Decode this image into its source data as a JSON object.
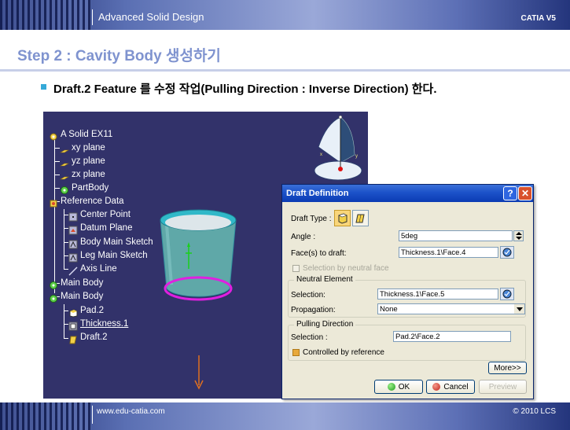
{
  "header": {
    "title": "Advanced Solid Design",
    "product": "CATIA V5"
  },
  "footer": {
    "url": "www.edu-catia.com",
    "copyright": "© 2010 LCS"
  },
  "step_title": "Step 2 : Cavity Body 생성하기",
  "bullet_text": "Draft.2 Feature 를 수정 작업(Pulling Direction : Inverse Direction) 한다.",
  "tree": {
    "items": [
      {
        "label": "A Solid EX11",
        "icon": "part-icon"
      },
      {
        "label": "xy plane",
        "icon": "plane-icon"
      },
      {
        "label": "yz plane",
        "icon": "plane-icon"
      },
      {
        "label": "zx plane",
        "icon": "plane-icon"
      },
      {
        "label": "PartBody",
        "icon": "body-icon"
      },
      {
        "label": "Reference Data",
        "icon": "geoset-icon"
      },
      {
        "label": "Center Point",
        "icon": "point-icon"
      },
      {
        "label": "Datum Plane",
        "icon": "datum-icon"
      },
      {
        "label": "Body Main Sketch",
        "icon": "sketch-icon"
      },
      {
        "label": "Leg Main Sketch",
        "icon": "sketch-icon"
      },
      {
        "label": "Axis Line",
        "icon": "line-icon"
      },
      {
        "label": "Main Body",
        "icon": "body-icon"
      },
      {
        "label": "Main Body",
        "icon": "body-icon"
      },
      {
        "label": "Pad.2",
        "icon": "pad-icon"
      },
      {
        "label": "Thickness.1",
        "icon": "thickness-icon"
      },
      {
        "label": "Draft.2",
        "icon": "draft-icon"
      }
    ]
  },
  "dialog": {
    "title": "Draft Definition",
    "help_label": "?",
    "close_label": "✕",
    "draft_type_label": "Draft Type :",
    "angle_label": "Angle :",
    "angle_value": "5deg",
    "faces_label": "Face(s) to draft:",
    "faces_value": "Thickness.1\\Face.4",
    "selection_by_neutral_label": "Selection by neutral face",
    "neutral_group_title": "Neutral Element",
    "neutral_selection_label": "Selection:",
    "neutral_selection_value": "Thickness.1\\Face.5",
    "propagation_label": "Propagation:",
    "propagation_value": "None",
    "pulling_group_title": "Pulling Direction",
    "pulling_selection_label": "Selection :",
    "pulling_selection_value": "Pad.2\\Face.2",
    "controlled_by_reference_label": "Controlled by reference",
    "more_label": "More>>",
    "ok_label": "OK",
    "cancel_label": "Cancel",
    "preview_label": "Preview"
  },
  "colors": {
    "viewport_bg": "#32326a",
    "title_accent": "#7f93cf",
    "cup_body": "#5fa8a8",
    "cup_rim": "#30b8c8",
    "ellipse_highlight": "#e020e0"
  }
}
